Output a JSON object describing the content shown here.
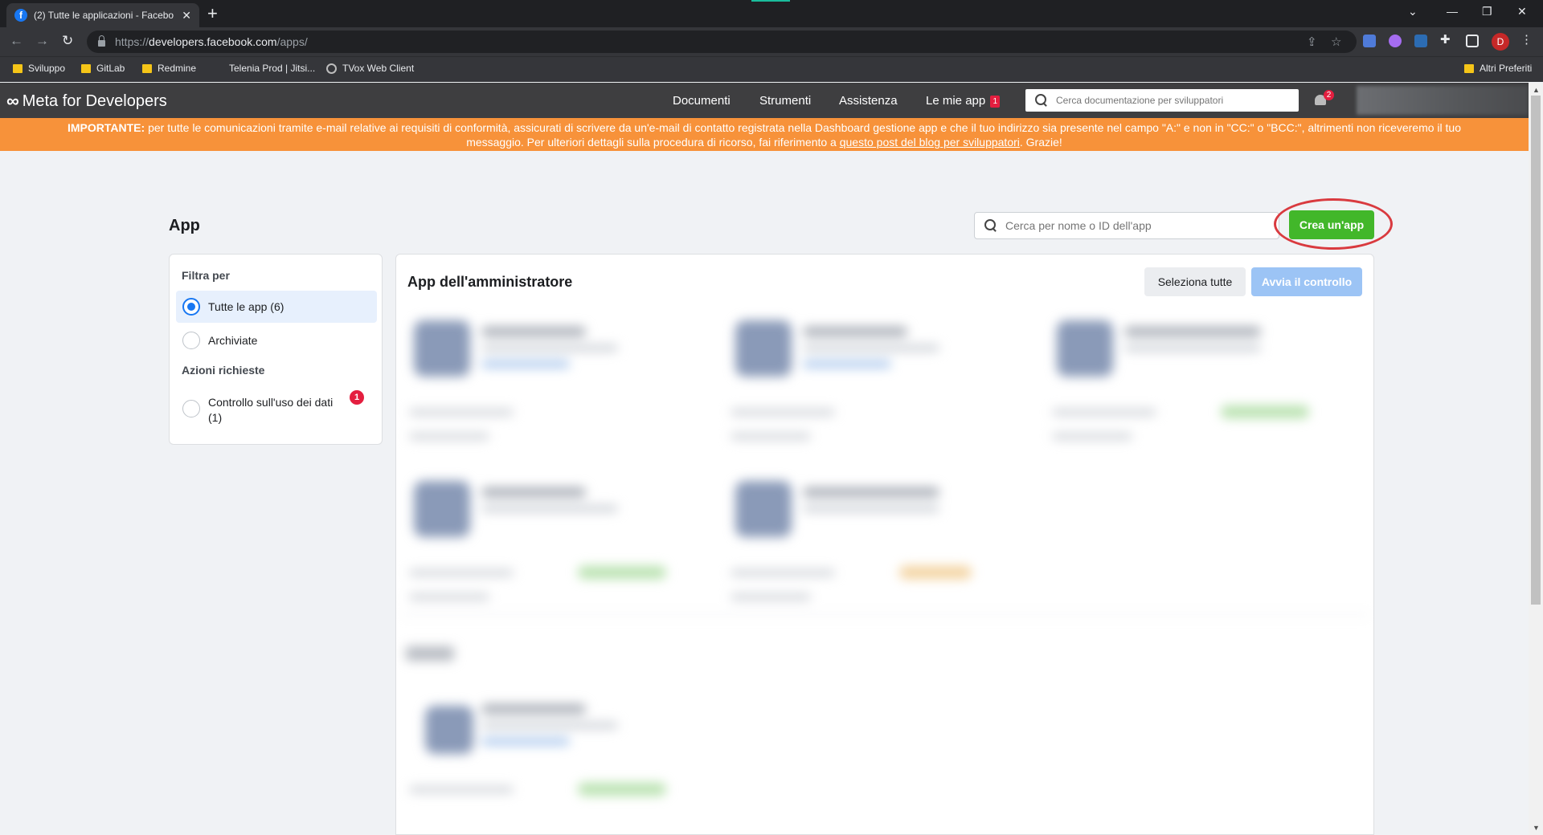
{
  "browser": {
    "tab_title": "(2) Tutte le applicazioni - Facebo",
    "tab_favicon": "f",
    "url_scheme": "https://",
    "url_host": "developers.facebook.com",
    "url_path": "/apps/",
    "profile_initial": "D",
    "bookmarks": [
      {
        "label": "Sviluppo",
        "icon": "folder-icon"
      },
      {
        "label": "GitLab",
        "icon": "folder-icon"
      },
      {
        "label": "Redmine",
        "icon": "folder-icon"
      },
      {
        "label": "Telenia Prod | Jitsi...",
        "icon": "none"
      },
      {
        "label": "TVox Web Client",
        "icon": "globe-icon"
      }
    ],
    "other_bookmarks": "Altri Preferiti"
  },
  "header": {
    "logo_text": "Meta for Developers",
    "nav": {
      "docs": "Documenti",
      "tools": "Strumenti",
      "support": "Assistenza",
      "my_apps": "Le mie app",
      "my_apps_badge": "1"
    },
    "search_placeholder": "Cerca documentazione per sviluppatori",
    "notification_count": "2"
  },
  "banner": {
    "strong": "IMPORTANTE:",
    "text_1": " per tutte le comunicazioni tramite e-mail relative ai requisiti di conformità, assicurati di scrivere da un'e-mail di contatto registrata nella Dashboard gestione app e che il tuo indirizzo sia presente nel campo \"A:\" e non in \"CC:\" o \"BCC:\", altrimenti non riceveremo il tuo messaggio. Per ulteriori dettagli sulla procedura di ricorso, fai riferimento a ",
    "link": "questo post del blog per sviluppatori",
    "text_2": ". Grazie!"
  },
  "page": {
    "title": "App",
    "search_placeholder": "Cerca per nome o ID dell'app",
    "create_button": "Crea un'app"
  },
  "filters": {
    "heading": "Filtra per",
    "all_apps": "Tutte le app (6)",
    "archived": "Archiviate",
    "actions_heading": "Azioni richieste",
    "data_use": "Controllo sull'uso dei dati (1)",
    "data_use_badge": "1"
  },
  "admin_panel": {
    "title": "App dell'amministratore",
    "select_all": "Seleziona tutte",
    "start_check": "Avvia il controllo"
  },
  "colors": {
    "accent_green": "#42b72a",
    "accent_blue": "#1877f2",
    "banner_orange": "#f7923a",
    "highlight_ring": "#d93a3f"
  }
}
